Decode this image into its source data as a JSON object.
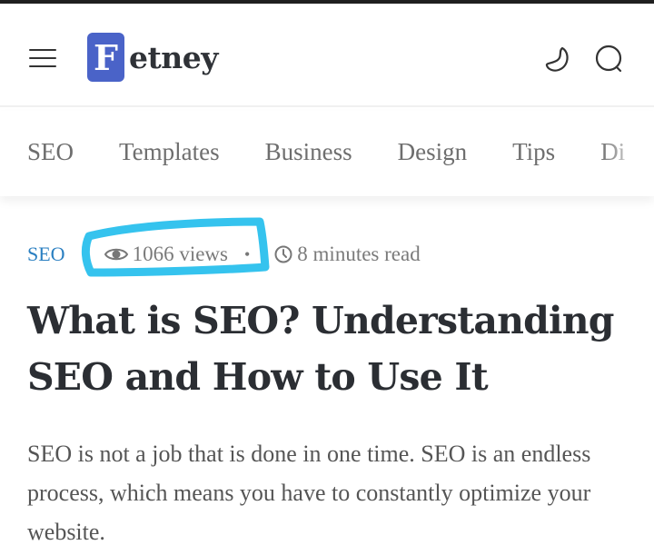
{
  "header": {
    "menu_icon": "hamburger-menu-icon",
    "logo": {
      "mark_letter": "F",
      "text": "etney",
      "mark_color": "#4a63c8"
    },
    "dark_mode_icon": "moon-icon",
    "search_icon": "search-icon"
  },
  "category_nav": {
    "items": [
      {
        "label": "SEO"
      },
      {
        "label": "Templates"
      },
      {
        "label": "Business"
      },
      {
        "label": "Design"
      },
      {
        "label": "Tips"
      },
      {
        "label": "Di"
      }
    ]
  },
  "article": {
    "category": "SEO",
    "category_color": "#2a7fc1",
    "views": "1066 views",
    "separator": "•",
    "read_time": "8 minutes read",
    "title": "What is SEO? Understanding SEO and How to Use It",
    "excerpt": "SEO is not a job that is done in one time. SEO is an endless process, which means you have to constantly optimize your website."
  },
  "annotation": {
    "type": "hand-drawn-highlight",
    "color": "#35c3ee",
    "target": "views-count"
  }
}
